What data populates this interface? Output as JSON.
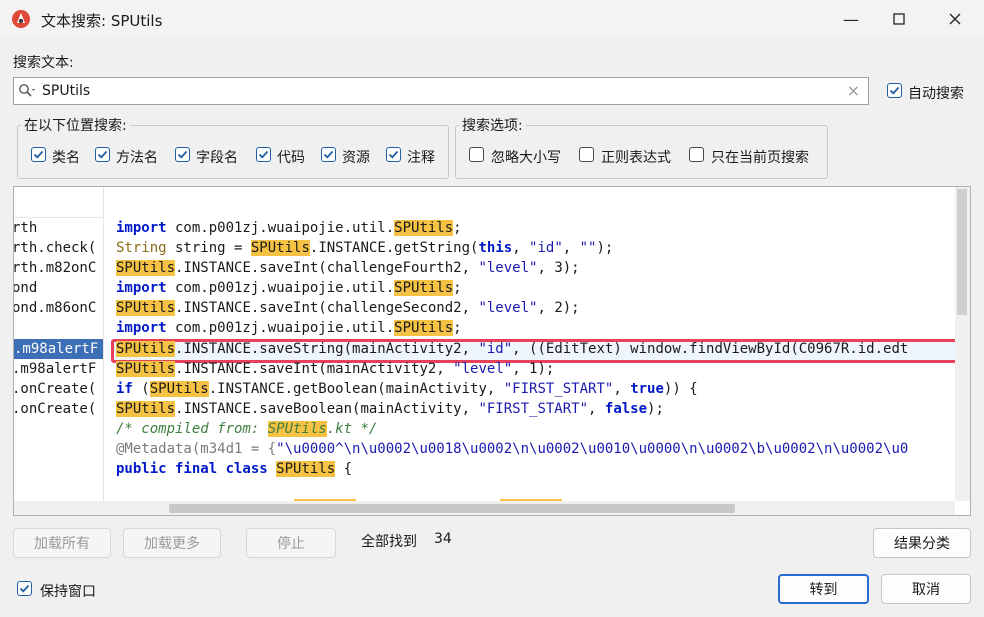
{
  "window": {
    "title": "文本搜索: SPUtils"
  },
  "search": {
    "label": "搜索文本:",
    "value": "SPUtils",
    "auto_search_label": "自动搜索",
    "auto_search_checked": true
  },
  "location_group": {
    "title": "在以下位置搜索:",
    "options": [
      {
        "label": "类名",
        "checked": true
      },
      {
        "label": "方法名",
        "checked": true
      },
      {
        "label": "字段名",
        "checked": true
      },
      {
        "label": "代码",
        "checked": true
      },
      {
        "label": "资源",
        "checked": true
      },
      {
        "label": "注释",
        "checked": true
      }
    ]
  },
  "options_group": {
    "title": "搜索选项:",
    "options": [
      {
        "label": "忽略大小写",
        "checked": false
      },
      {
        "label": "正则表达式",
        "checked": false
      },
      {
        "label": "只在当前页搜索",
        "checked": false
      }
    ]
  },
  "results": {
    "left_column": [
      "rth",
      "rth.check(",
      "rth.m82onC",
      "ond",
      "ond.m86onC",
      "",
      ".m98alertF",
      ".m98alertF",
      ".onCreate(",
      ".onCreate("
    ],
    "code": [
      [
        "import",
        " com.p001zj.wuaipojie.util.",
        "SPUtils",
        ";"
      ],
      [
        "String",
        " string = ",
        "SPUtils",
        ".INSTANCE.getString(",
        "this",
        ", ",
        "\"id\"",
        ", ",
        "\"\"",
        ");"
      ],
      [
        "SPUtils",
        ".INSTANCE.saveInt(challengeFourth2, ",
        "\"level\"",
        ", 3);"
      ],
      [
        "import",
        " com.p001zj.wuaipojie.util.",
        "SPUtils",
        ";"
      ],
      [
        "SPUtils",
        ".INSTANCE.saveInt(challengeSecond2, ",
        "\"level\"",
        ", 2);"
      ],
      [
        "import",
        " com.p001zj.wuaipojie.util.",
        "SPUtils",
        ";"
      ],
      [
        "SPUtils",
        ".INSTANCE.saveString(mainActivity2, ",
        "\"id\"",
        ", ((EditText) window.findViewById(C0967R.id.edt"
      ],
      [
        "SPUtils",
        ".INSTANCE.saveInt(mainActivity2, ",
        "\"level\"",
        ", 1);"
      ],
      [
        "if",
        " (",
        "SPUtils",
        ".INSTANCE.getBoolean(mainActivity, ",
        "\"FIRST_START\"",
        ", ",
        "true",
        ")) {"
      ],
      [
        "SPUtils",
        ".INSTANCE.saveBoolean(mainActivity, ",
        "\"FIRST_START\"",
        ", ",
        "false",
        ");"
      ],
      [
        "/* compiled from: ",
        "SPUtils",
        ".kt */"
      ],
      [
        "@Metadata(m34d1 = {",
        "\"\\u0000^\\n\\u0002\\u0018\\u0002\\n\\u0002\\u0010\\u0000\\n\\u0002\\b\\u0002\\n\\u0002\\u0"
      ],
      [
        "public final class",
        " ",
        "SPUtils",
        " {"
      ]
    ]
  },
  "buttons": {
    "load_all": "加载所有",
    "load_more": "加载更多",
    "stop": "停止",
    "found_label": "全部找到",
    "found_count": "34",
    "categorize": "结果分类",
    "keep_window": "保持窗口",
    "keep_window_checked": true,
    "goto": "转到",
    "cancel": "取消"
  },
  "colors": {
    "accent": "#2b6ad0",
    "highlight": "#f6c243",
    "selection": "#3d6fb6",
    "focus_rect": "#e8415b"
  }
}
